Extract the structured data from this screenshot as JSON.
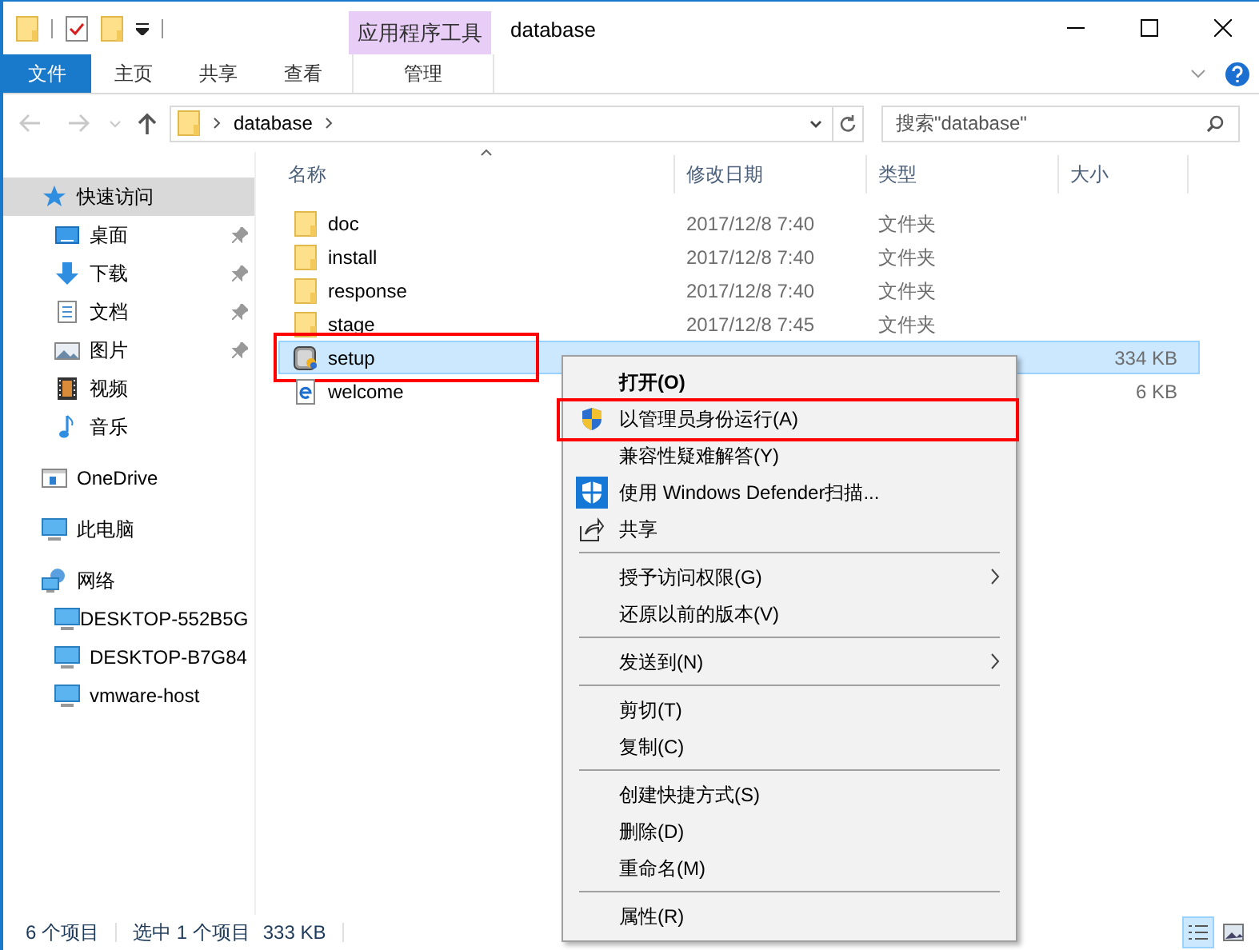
{
  "window": {
    "title": "database",
    "contextual_tab": "应用程序工具"
  },
  "ribbon_tabs": [
    {
      "label": "文件",
      "kind": "file"
    },
    {
      "label": "主页",
      "kind": "tab"
    },
    {
      "label": "共享",
      "kind": "tab"
    },
    {
      "label": "查看",
      "kind": "tab"
    },
    {
      "label": "管理",
      "kind": "contextual"
    }
  ],
  "address_bar": {
    "path": [
      "database"
    ]
  },
  "search": {
    "placeholder": "搜索\"database\""
  },
  "sidebar": {
    "items": [
      {
        "label": "快速访问",
        "kind": "star",
        "selected": true,
        "children": [
          {
            "label": "桌面",
            "kind": "desktop",
            "pinned": true
          },
          {
            "label": "下载",
            "kind": "download",
            "pinned": true
          },
          {
            "label": "文档",
            "kind": "document",
            "pinned": true
          },
          {
            "label": "图片",
            "kind": "pictures",
            "pinned": true
          },
          {
            "label": "视频",
            "kind": "video",
            "pinned": false
          },
          {
            "label": "音乐",
            "kind": "music",
            "pinned": false
          }
        ]
      },
      {
        "label": "OneDrive",
        "kind": "cloud",
        "selected": false
      },
      {
        "label": "此电脑",
        "kind": "computer",
        "selected": false
      },
      {
        "label": "网络",
        "kind": "network",
        "selected": false,
        "children": [
          {
            "label": "DESKTOP-552B5G",
            "kind": "computer",
            "pinned": false
          },
          {
            "label": "DESKTOP-B7G84",
            "kind": "computer",
            "pinned": false
          },
          {
            "label": "vmware-host",
            "kind": "computer",
            "pinned": false
          }
        ]
      }
    ]
  },
  "table": {
    "columns": [
      {
        "label": "名称",
        "sorted": true
      },
      {
        "label": "修改日期",
        "sorted": false
      },
      {
        "label": "类型",
        "sorted": false
      },
      {
        "label": "大小",
        "sorted": false
      }
    ],
    "rows": [
      {
        "name": "doc",
        "kind": "folder",
        "modified": "2017/12/8 7:40",
        "type": "文件夹",
        "selected": false,
        "highlighted": false
      },
      {
        "name": "install",
        "kind": "folder",
        "modified": "2017/12/8 7:40",
        "type": "文件夹",
        "selected": false,
        "highlighted": false
      },
      {
        "name": "response",
        "kind": "folder",
        "modified": "2017/12/8 7:40",
        "type": "文件夹",
        "selected": false,
        "highlighted": false
      },
      {
        "name": "stage",
        "kind": "folder",
        "modified": "2017/12/8 7:45",
        "type": "文件夹",
        "selected": false,
        "highlighted": false
      },
      {
        "name": "setup",
        "kind": "app",
        "size": "334 KB",
        "selected": true,
        "highlighted": true
      },
      {
        "name": "welcome",
        "kind": "html",
        "size": "6 KB",
        "selected": false,
        "highlighted": false
      }
    ]
  },
  "context_menu": {
    "items": [
      {
        "kind": "item",
        "label": "打开(O)",
        "default": true,
        "highlighted": false,
        "submenu": false
      },
      {
        "kind": "elevated",
        "label": "以管理员身份运行(A)",
        "default": false,
        "highlighted": true,
        "submenu": false
      },
      {
        "kind": "item",
        "label": "兼容性疑难解答(Y)",
        "default": false,
        "highlighted": false,
        "submenu": false
      },
      {
        "kind": "scan",
        "label": "使用 Windows Defender扫描...",
        "default": false,
        "highlighted": false,
        "submenu": false
      },
      {
        "kind": "share",
        "label": "共享",
        "default": false,
        "highlighted": false,
        "submenu": false
      },
      {
        "kind": "separator"
      },
      {
        "kind": "item",
        "label": "授予访问权限(G)",
        "default": false,
        "highlighted": false,
        "submenu": true
      },
      {
        "kind": "item",
        "label": "还原以前的版本(V)",
        "default": false,
        "highlighted": false,
        "submenu": false
      },
      {
        "kind": "separator"
      },
      {
        "kind": "item",
        "label": "发送到(N)",
        "default": false,
        "highlighted": false,
        "submenu": true
      },
      {
        "kind": "separator"
      },
      {
        "kind": "item",
        "label": "剪切(T)",
        "default": false,
        "highlighted": false,
        "submenu": false
      },
      {
        "kind": "item",
        "label": "复制(C)",
        "default": false,
        "highlighted": false,
        "submenu": false
      },
      {
        "kind": "separator"
      },
      {
        "kind": "item",
        "label": "创建快捷方式(S)",
        "default": false,
        "highlighted": false,
        "submenu": false
      },
      {
        "kind": "item",
        "label": "删除(D)",
        "default": false,
        "highlighted": false,
        "submenu": false
      },
      {
        "kind": "item",
        "label": "重命名(M)",
        "default": false,
        "highlighted": false,
        "submenu": false
      },
      {
        "kind": "separator"
      },
      {
        "kind": "item",
        "label": "属性(R)",
        "default": false,
        "highlighted": false,
        "submenu": false
      }
    ]
  },
  "status_bar": {
    "items": [
      "6 个项目",
      "选中 1 个项目",
      "333 KB"
    ]
  },
  "view_buttons": [
    {
      "kind": "details",
      "selected": true
    },
    {
      "kind": "large-icons",
      "selected": false
    }
  ]
}
